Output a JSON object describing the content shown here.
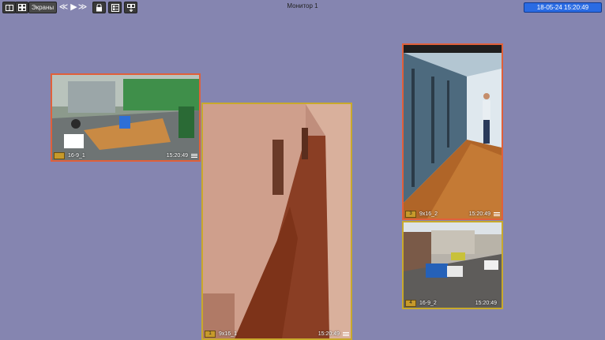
{
  "toolbar": {
    "screens_label": "Экраны",
    "prev_glyph": "≪",
    "play_glyph": "▶",
    "next_glyph": "≫",
    "icons": [
      "layout-icon",
      "grid-icon",
      "lock-icon",
      "list-icon",
      "download-icon"
    ]
  },
  "window": {
    "title": "Монитор 1"
  },
  "clock": {
    "value": "18-05-24 15:20:49"
  },
  "cameras": [
    {
      "num": "",
      "name": "16-9_1",
      "time": "15:20:49"
    },
    {
      "num": "1",
      "name": "9x16_1",
      "time": "15:20:49"
    },
    {
      "num": "3",
      "name": "9x16_2",
      "time": "15:20:49"
    },
    {
      "num": "4",
      "name": "16-9_2",
      "time": "15:20:49"
    }
  ],
  "colors": {
    "background": "#8585b0",
    "selected_border": "#e0603a",
    "border": "#c8a92c",
    "clock_bg": "#2a6be3"
  }
}
